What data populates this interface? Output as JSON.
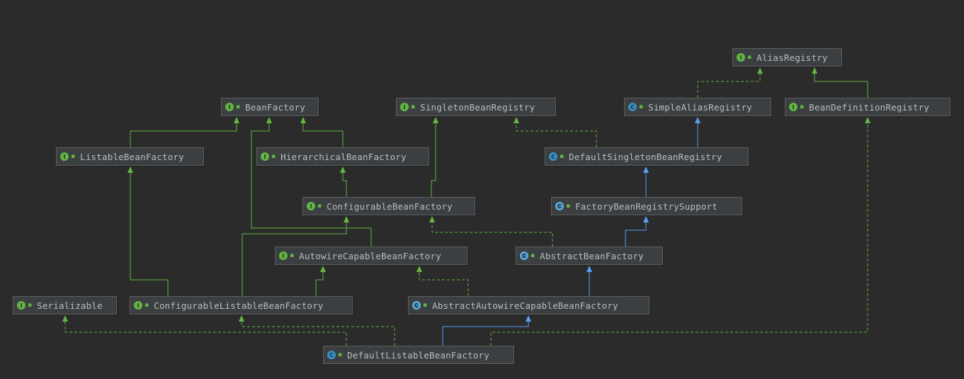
{
  "colors": {
    "background": "#2b2b2b",
    "node_fill": "#3c3f41",
    "node_border": "#5e5e5e",
    "text": "#bbbbbb",
    "implements_edge": "#62b543",
    "extends_class_edge": "#589df6",
    "interface_badge": "#62b543",
    "class_badge": "#3592c4"
  },
  "nodes": [
    {
      "id": "AliasRegistry",
      "label": "AliasRegistry",
      "kind": "interface",
      "icon": "interface-icon",
      "badge": "I"
    },
    {
      "id": "BeanFactory",
      "label": "BeanFactory",
      "kind": "interface",
      "icon": "interface-icon",
      "badge": "I"
    },
    {
      "id": "SingletonBeanRegistry",
      "label": "SingletonBeanRegistry",
      "kind": "interface",
      "icon": "interface-icon",
      "badge": "I"
    },
    {
      "id": "SimpleAliasRegistry",
      "label": "SimpleAliasRegistry",
      "kind": "class",
      "icon": "class-icon",
      "badge": "C"
    },
    {
      "id": "BeanDefinitionRegistry",
      "label": "BeanDefinitionRegistry",
      "kind": "interface",
      "icon": "interface-icon",
      "badge": "I"
    },
    {
      "id": "ListableBeanFactory",
      "label": "ListableBeanFactory",
      "kind": "interface",
      "icon": "interface-icon",
      "badge": "I"
    },
    {
      "id": "HierarchicalBeanFactory",
      "label": "HierarchicalBeanFactory",
      "kind": "interface",
      "icon": "interface-icon",
      "badge": "I"
    },
    {
      "id": "DefaultSingletonBeanRegistry",
      "label": "DefaultSingletonBeanRegistry",
      "kind": "class",
      "icon": "class-icon",
      "badge": "C"
    },
    {
      "id": "ConfigurableBeanFactory",
      "label": "ConfigurableBeanFactory",
      "kind": "interface",
      "icon": "interface-icon",
      "badge": "I"
    },
    {
      "id": "FactoryBeanRegistrySupport",
      "label": "FactoryBeanRegistrySupport",
      "kind": "abstract",
      "icon": "abstract-class-icon",
      "badge": "C"
    },
    {
      "id": "AutowireCapableBeanFactory",
      "label": "AutowireCapableBeanFactory",
      "kind": "interface",
      "icon": "interface-icon",
      "badge": "I"
    },
    {
      "id": "AbstractBeanFactory",
      "label": "AbstractBeanFactory",
      "kind": "abstract",
      "icon": "abstract-class-icon",
      "badge": "C"
    },
    {
      "id": "Serializable",
      "label": "Serializable",
      "kind": "interface",
      "icon": "interface-icon",
      "badge": "I"
    },
    {
      "id": "ConfigurableListableBeanFactory",
      "label": "ConfigurableListableBeanFactory",
      "kind": "interface",
      "icon": "interface-icon",
      "badge": "I"
    },
    {
      "id": "AbstractAutowireCapableBeanFactory",
      "label": "AbstractAutowireCapableBeanFactory",
      "kind": "abstract",
      "icon": "abstract-class-icon",
      "badge": "C"
    },
    {
      "id": "DefaultListableBeanFactory",
      "label": "DefaultListableBeanFactory",
      "kind": "class",
      "icon": "class-icon",
      "badge": "C"
    }
  ],
  "edges": [
    {
      "from": "SimpleAliasRegistry",
      "to": "AliasRegistry",
      "style": "implements"
    },
    {
      "from": "BeanDefinitionRegistry",
      "to": "AliasRegistry",
      "style": "extends-interface"
    },
    {
      "from": "ListableBeanFactory",
      "to": "BeanFactory",
      "style": "extends-interface"
    },
    {
      "from": "HierarchicalBeanFactory",
      "to": "BeanFactory",
      "style": "extends-interface"
    },
    {
      "from": "AutowireCapableBeanFactory",
      "to": "BeanFactory",
      "style": "extends-interface"
    },
    {
      "from": "DefaultSingletonBeanRegistry",
      "to": "SingletonBeanRegistry",
      "style": "implements"
    },
    {
      "from": "DefaultSingletonBeanRegistry",
      "to": "SimpleAliasRegistry",
      "style": "extends-class"
    },
    {
      "from": "ConfigurableBeanFactory",
      "to": "HierarchicalBeanFactory",
      "style": "extends-interface"
    },
    {
      "from": "ConfigurableBeanFactory",
      "to": "SingletonBeanRegistry",
      "style": "extends-interface"
    },
    {
      "from": "FactoryBeanRegistrySupport",
      "to": "DefaultSingletonBeanRegistry",
      "style": "extends-class"
    },
    {
      "from": "AbstractBeanFactory",
      "to": "FactoryBeanRegistrySupport",
      "style": "extends-class"
    },
    {
      "from": "AbstractBeanFactory",
      "to": "ConfigurableBeanFactory",
      "style": "implements"
    },
    {
      "from": "ConfigurableListableBeanFactory",
      "to": "ListableBeanFactory",
      "style": "extends-interface"
    },
    {
      "from": "ConfigurableListableBeanFactory",
      "to": "ConfigurableBeanFactory",
      "style": "extends-interface"
    },
    {
      "from": "ConfigurableListableBeanFactory",
      "to": "AutowireCapableBeanFactory",
      "style": "extends-interface"
    },
    {
      "from": "AbstractAutowireCapableBeanFactory",
      "to": "AbstractBeanFactory",
      "style": "extends-class"
    },
    {
      "from": "AbstractAutowireCapableBeanFactory",
      "to": "AutowireCapableBeanFactory",
      "style": "implements"
    },
    {
      "from": "DefaultListableBeanFactory",
      "to": "AbstractAutowireCapableBeanFactory",
      "style": "extends-class"
    },
    {
      "from": "DefaultListableBeanFactory",
      "to": "ConfigurableListableBeanFactory",
      "style": "implements"
    },
    {
      "from": "DefaultListableBeanFactory",
      "to": "BeanDefinitionRegistry",
      "style": "implements"
    },
    {
      "from": "DefaultListableBeanFactory",
      "to": "Serializable",
      "style": "implements"
    }
  ]
}
